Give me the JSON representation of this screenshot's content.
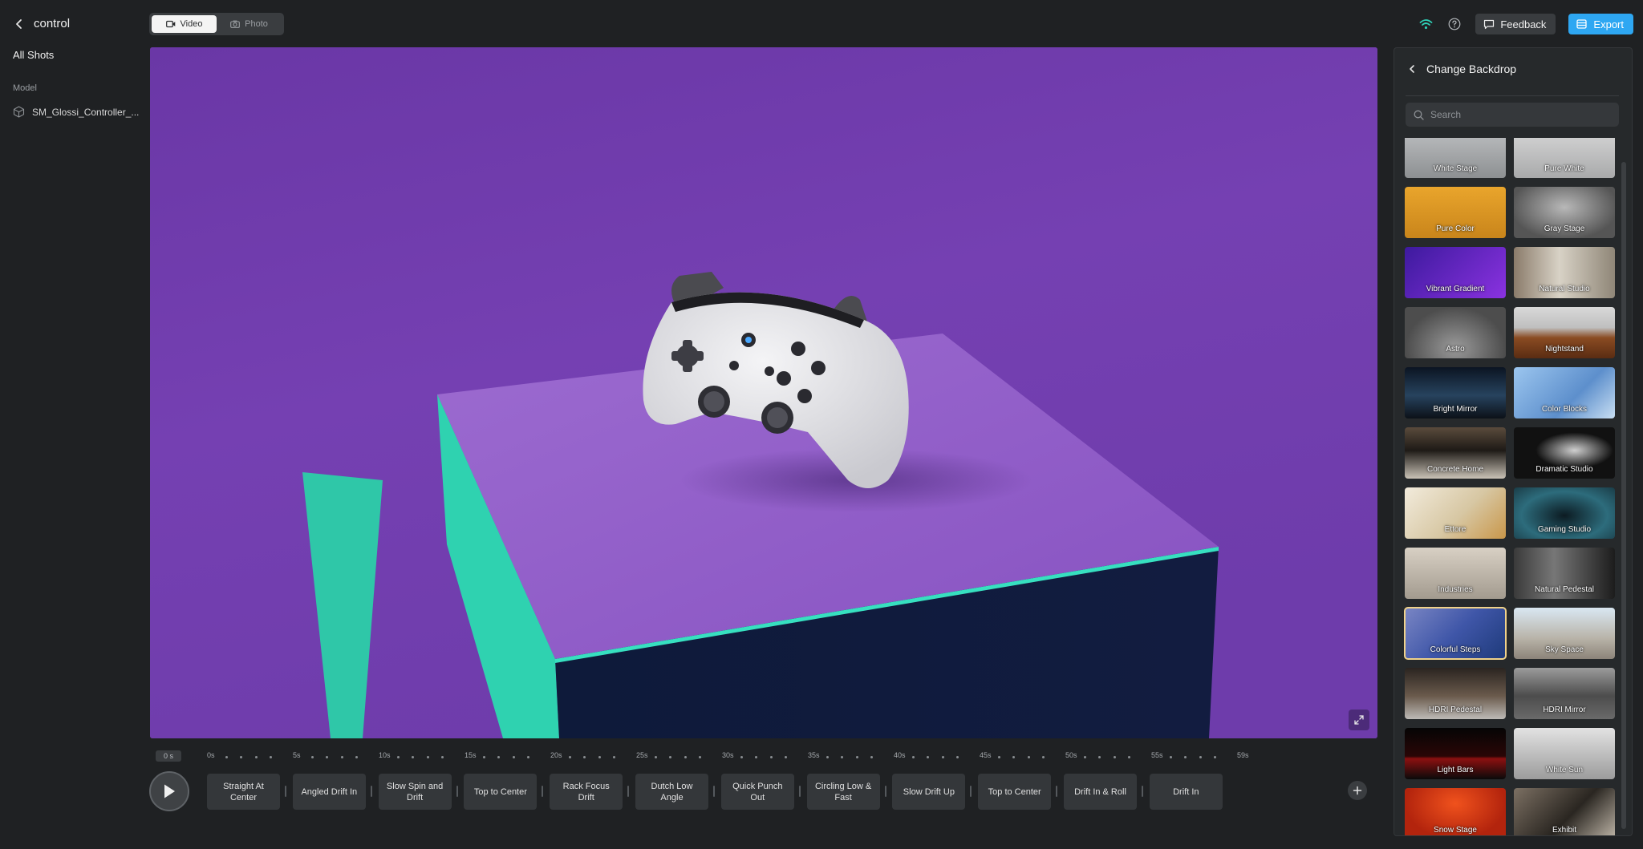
{
  "header": {
    "title": "control",
    "modes": [
      {
        "label": "Video",
        "active": true,
        "icon": "video-camera-icon"
      },
      {
        "label": "Photo",
        "active": false,
        "icon": "camera-icon"
      }
    ],
    "feedback_label": "Feedback",
    "export_label": "Export",
    "accent_color": "#2ea7f2"
  },
  "sidebar": {
    "all_shots_label": "All Shots",
    "model_section_label": "Model",
    "model_name": "SM_Glossi_Controller_..."
  },
  "timeline": {
    "current_time": "0 s",
    "ticks": [
      "0s",
      "5s",
      "10s",
      "15s",
      "20s",
      "25s",
      "30s",
      "35s",
      "40s",
      "45s",
      "50s",
      "55s",
      "59s"
    ],
    "shots": [
      "Straight At Center",
      "Angled Drift In",
      "Slow Spin and Drift",
      "Top to Center",
      "Rack Focus Drift",
      "Dutch Low Angle",
      "Quick Punch Out",
      "Circling Low & Fast",
      "Slow Drift Up",
      "Top to Center",
      "Drift In & Roll",
      "Drift In"
    ]
  },
  "backdrop_panel": {
    "title": "Change Backdrop",
    "search_placeholder": "Search",
    "selected": "Colorful Steps",
    "items": [
      {
        "label": "White Stage",
        "bg": "linear-gradient(#bfc1c3,#8d9092)"
      },
      {
        "label": "Pure White",
        "bg": "linear-gradient(#d8d8d8,#a9aaab)"
      },
      {
        "label": "Pure Color",
        "bg": "linear-gradient(#e9a52c,#c9851b)"
      },
      {
        "label": "Gray Stage",
        "bg": "radial-gradient(ellipse at 50% 40%,#b8b8b8,#555 75%)"
      },
      {
        "label": "Vibrant Gradient",
        "bg": "linear-gradient(135deg,#3d1a9e,#8a32e0)"
      },
      {
        "label": "Natural Studio",
        "bg": "linear-gradient(90deg,#8a7b6a,#d8d2c6 45%,#8f8677)"
      },
      {
        "label": "Astro",
        "bg": "radial-gradient(ellipse at 50% 80%,#9a9a9a,#4d4d4d 70%)"
      },
      {
        "label": "Nightstand",
        "bg": "linear-gradient(#d9d9d9 0%,#bfbfbf 40%,#8a4b22 60%,#5a2c12)"
      },
      {
        "label": "Bright Mirror",
        "bg": "linear-gradient(#0b1422,#27435e 55%,#0c1118)"
      },
      {
        "label": "Color Blocks",
        "bg": "linear-gradient(135deg,#9cc6ef,#5d8fcc 60%,#c9dff3)"
      },
      {
        "label": "Concrete Home",
        "bg": "linear-gradient(#5a4b3c,#1e1a16 45%,#c9c2b6)"
      },
      {
        "label": "Dramatic Studio",
        "bg": "radial-gradient(ellipse at 60% 45%,#cfcfcf,#111 45%)"
      },
      {
        "label": "Ettore",
        "bg": "linear-gradient(135deg,#f2ebdc,#d7c7a3 55%,#c9974a)"
      },
      {
        "label": "Gaming Studio",
        "bg": "radial-gradient(ellipse at 50% 55%,#0c1b22,#2d6c7c 60%,#1a3c47)"
      },
      {
        "label": "Industries",
        "bg": "linear-gradient(#d8d0c4,#a39b8f)"
      },
      {
        "label": "Natural Pedestal",
        "bg": "linear-gradient(90deg,#3a3a3a,#777 40%,#1c1c1c)"
      },
      {
        "label": "Colorful Steps",
        "bg": "linear-gradient(135deg,#7a86c4,#3f56a8 50%,#1e3a7a)"
      },
      {
        "label": "Sky Space",
        "bg": "linear-gradient(#d9e7f2,#b8b3a8 60%,#8c8479)"
      },
      {
        "label": "HDRI Pedestal",
        "bg": "linear-gradient(#2a2420,#6a5a4c 55%,#bdbab6)"
      },
      {
        "label": "HDRI Mirror",
        "bg": "linear-gradient(#9b9b9b,#4c4c4c 55%,#6a6a6a)"
      },
      {
        "label": "Light Bars",
        "bg": "linear-gradient(#050505,#2a0606 55%,#8c1010 60%,#0a0a0a)"
      },
      {
        "label": "White Sun",
        "bg": "linear-gradient(#e2e2e2,#9c9c9c)"
      },
      {
        "label": "Snow Stage",
        "bg": "radial-gradient(ellipse at 50% 30%,#f0521d,#b3240d 70%)"
      },
      {
        "label": "Exhibit",
        "bg": "linear-gradient(135deg,#7c7063,#2a2621 55%,#bfb6a8)"
      }
    ]
  }
}
